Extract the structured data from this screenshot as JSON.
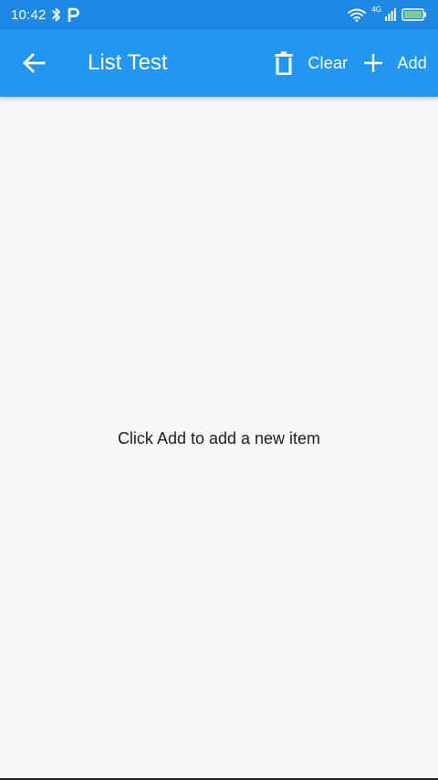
{
  "status_bar": {
    "time": "10:42",
    "network_label": "4G",
    "icons": [
      "bluetooth-icon",
      "p-app-icon",
      "wifi-icon",
      "signal-icon",
      "battery-icon"
    ]
  },
  "app_bar": {
    "title": "List Test",
    "back_icon": "arrow-left-icon",
    "actions": [
      {
        "label": "Clear",
        "icon": "trash-icon"
      },
      {
        "label": "Add",
        "icon": "plus-icon"
      }
    ]
  },
  "content": {
    "empty_message": "Click Add to add a new item"
  },
  "colors": {
    "status_bar": "#1e88e5",
    "app_bar": "#2196f3",
    "background": "#f7f7f7",
    "text": "#212121"
  }
}
